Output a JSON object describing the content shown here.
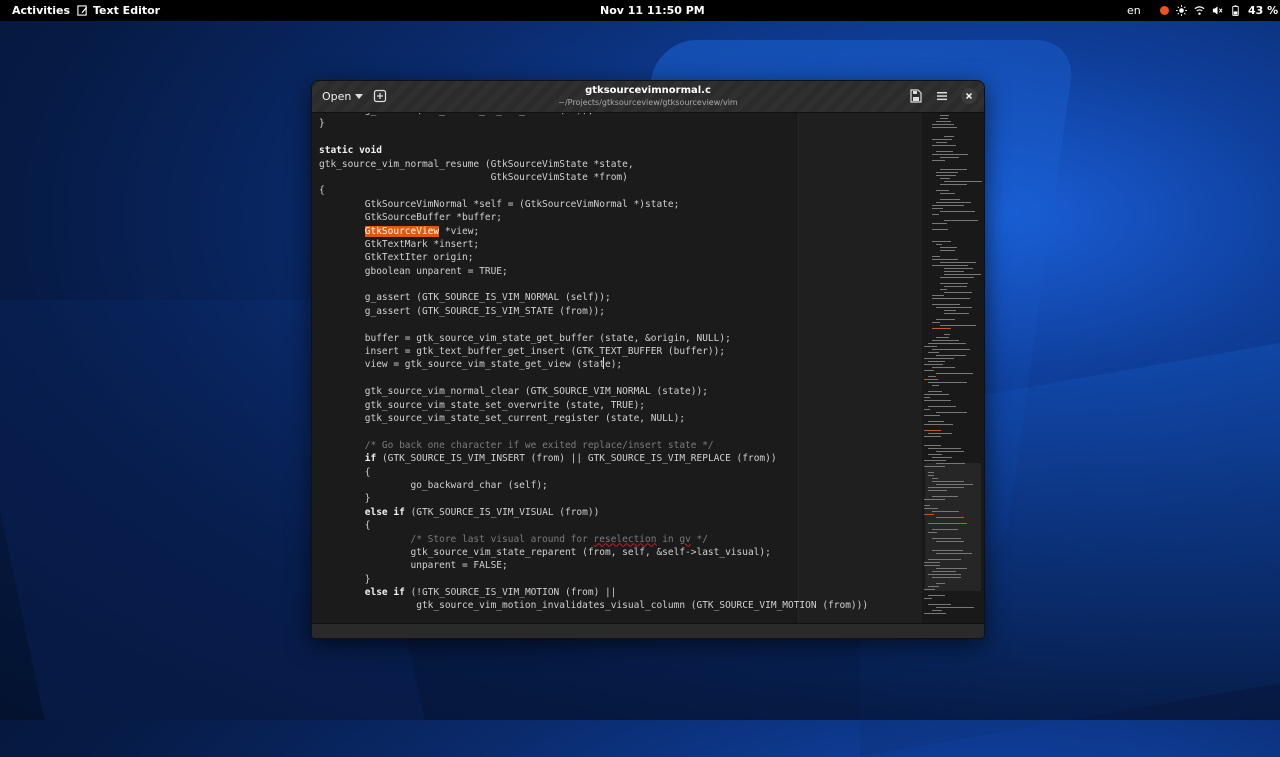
{
  "topbar": {
    "activities": "Activities",
    "app_name": "Text Editor",
    "clock": "Nov 11  11:50 PM",
    "lang": "en",
    "battery": "43 %"
  },
  "window": {
    "open_label": "Open",
    "title": "gtksourcevimnormal.c",
    "path": "~/Projects/gtksourceview/gtksourceview/vim"
  },
  "code_lines": [
    "        g_assert (GTK_SOURCE_IS_VIM_STATE (to));",
    "}",
    "",
    "static void",
    "gtk_source_vim_normal_resume (GtkSourceVimState *state,",
    "                              GtkSourceVimState *from)",
    "{",
    "        GtkSourceVimNormal *self = (GtkSourceVimNormal *)state;",
    "        GtkSourceBuffer *buffer;",
    "        GtkSourceView *view;",
    "        GtkTextMark *insert;",
    "        GtkTextIter origin;",
    "        gboolean unparent = TRUE;",
    "",
    "        g_assert (GTK_SOURCE_IS_VIM_NORMAL (self));",
    "        g_assert (GTK_SOURCE_IS_VIM_STATE (from));",
    "",
    "        buffer = gtk_source_vim_state_get_buffer (state, &origin, NULL);",
    "        insert = gtk_text_buffer_get_insert (GTK_TEXT_BUFFER (buffer));",
    "        view = gtk_source_vim_state_get_view (state);",
    "",
    "        gtk_source_vim_normal_clear (GTK_SOURCE_VIM_NORMAL (state));",
    "        gtk_source_vim_state_set_overwrite (state, TRUE);",
    "        gtk_source_vim_state_set_current_register (state, NULL);",
    "",
    "        /* Go back one character if we exited replace/insert state */",
    "        if (GTK_SOURCE_IS_VIM_INSERT (from) || GTK_SOURCE_IS_VIM_REPLACE (from))",
    "        {",
    "                go_backward_char (self);",
    "        }",
    "        else if (GTK_SOURCE_IS_VIM_VISUAL (from))",
    "        {",
    "                /* Store last visual around for reselection in gv */",
    "                gtk_source_vim_state_reparent (from, self, &self->last_visual);",
    "                unparent = FALSE;",
    "        }",
    "        else if (!GTK_SOURCE_IS_VIM_MOTION (from) ||",
    "                 gtk_source_vim_motion_invalidates_visual_column (GTK_SOURCE_VIM_MOTION (from)))"
  ],
  "highlight_word": "GtkSourceView",
  "colors": {
    "accent": "#e2580c",
    "editor_bg": "#1b1b1b",
    "header_bg": "#2b2b2b"
  },
  "icons": {
    "open_caret": "chevron-down-icon",
    "new_tab": "new-tab-icon",
    "save": "save-icon",
    "menu": "hamburger-menu-icon",
    "close": "close-icon"
  }
}
